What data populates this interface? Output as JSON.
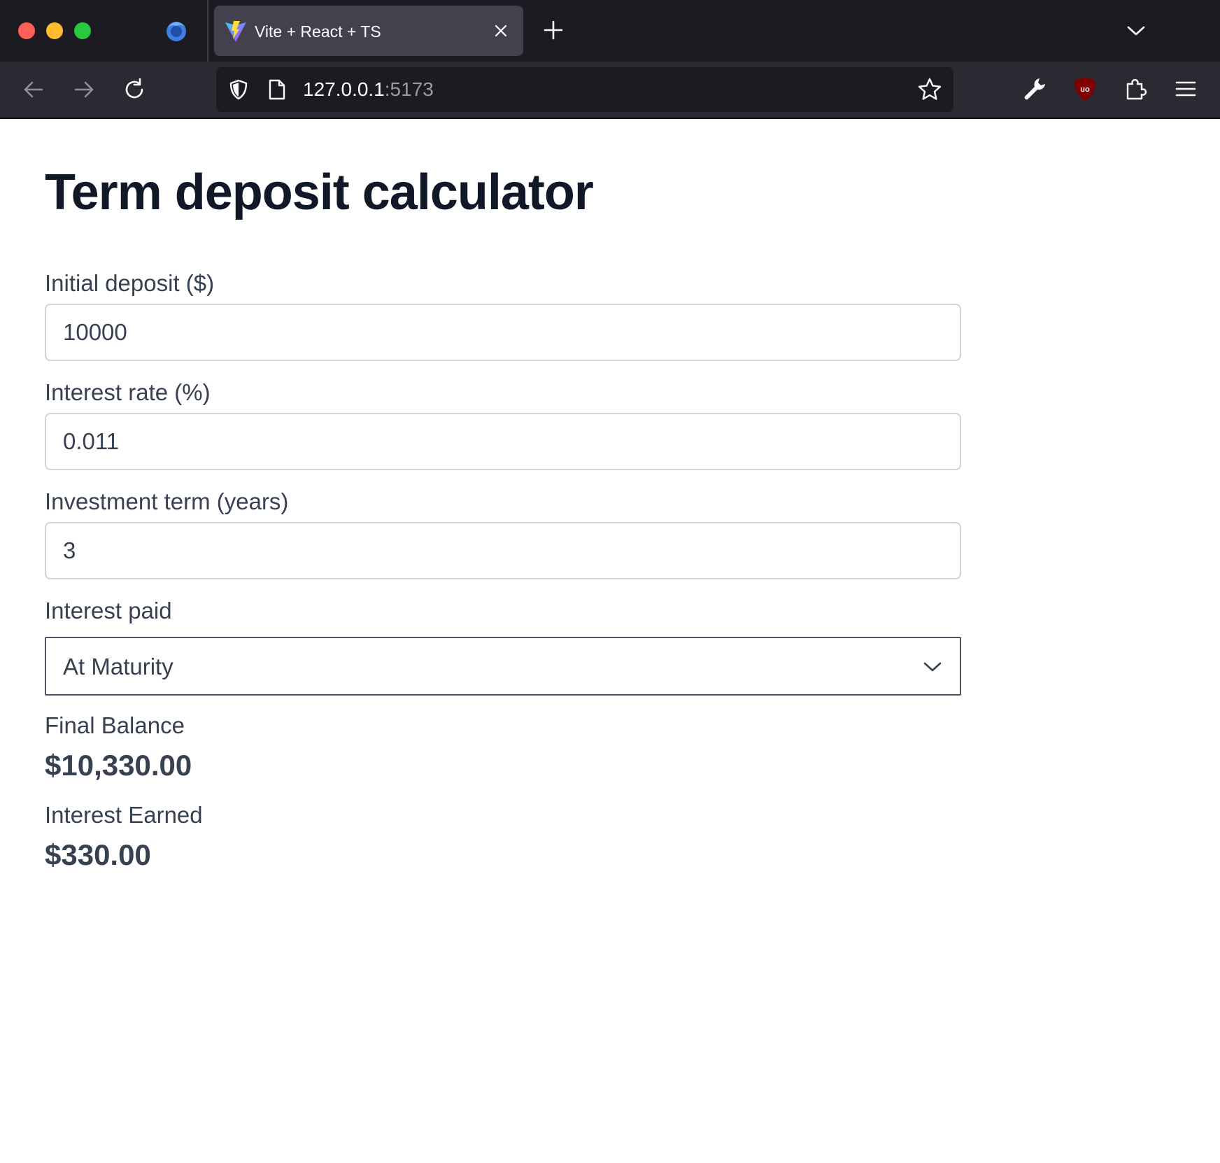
{
  "browser": {
    "tab": {
      "title": "Vite + React + TS"
    },
    "url": {
      "host": "127.0.0.1",
      "port": ":5173"
    }
  },
  "page": {
    "title": "Term deposit calculator",
    "fields": {
      "initial_deposit": {
        "label": "Initial deposit ($)",
        "value": "10000"
      },
      "interest_rate": {
        "label": "Interest rate (%)",
        "value": "0.011"
      },
      "investment_term": {
        "label": "Investment term (years)",
        "value": "3"
      },
      "interest_paid": {
        "label": "Interest paid",
        "value": "At Maturity"
      }
    },
    "results": {
      "final_balance": {
        "label": "Final Balance",
        "value": "$10,330.00"
      },
      "interest_earned": {
        "label": "Interest Earned",
        "value": "$330.00"
      }
    }
  },
  "colors": {
    "tabstrip_bg": "#1c1b22",
    "navbar_bg": "#2b2a33",
    "heading": "#111827",
    "body_text": "#374151",
    "input_border": "#d1d5db",
    "select_border": "#4b5563"
  },
  "icons": [
    "firefox-logo-icon",
    "vite-favicon-icon",
    "close-icon",
    "plus-icon",
    "chevron-down-icon",
    "back-arrow-icon",
    "forward-arrow-icon",
    "reload-icon",
    "shield-icon",
    "page-icon",
    "star-icon",
    "wrench-icon",
    "ublock-icon",
    "extensions-icon",
    "hamburger-menu-icon"
  ]
}
